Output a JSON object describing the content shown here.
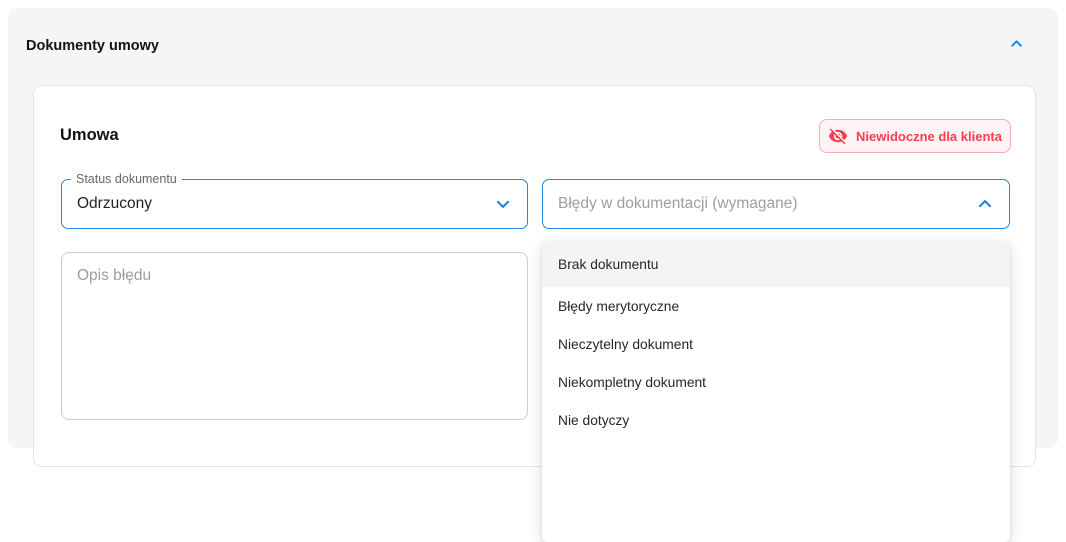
{
  "accordion": {
    "title": "Dokumenty umowy",
    "toggle_icon": "chevron-up-icon"
  },
  "card": {
    "title": "Umowa",
    "badge": {
      "label": "Niewidoczne dla klienta",
      "icon": "eye-slash-icon"
    },
    "status_select": {
      "label": "Status dokumentu",
      "value": "Odrzucony",
      "icon": "chevron-down-icon"
    },
    "errors_select": {
      "placeholder": "Błędy w dokumentacji (wymagane)",
      "icon": "chevron-up-icon"
    },
    "description_textarea": {
      "placeholder": "Opis błędu",
      "value": ""
    },
    "dropdown": {
      "items": [
        {
          "label": "Brak dokumentu",
          "highlighted": true
        },
        {
          "label": "Błędy merytoryczne",
          "highlighted": false
        },
        {
          "label": "Nieczytelny dokument",
          "highlighted": false
        },
        {
          "label": "Niekompletny dokument",
          "highlighted": false
        },
        {
          "label": "Nie dotyczy",
          "highlighted": false
        }
      ]
    }
  },
  "colors": {
    "accent_blue": "#1e88e5",
    "badge_red": "#f5414d",
    "panel_gray": "#f5f5f6",
    "highlight_gray": "#f4f4f5"
  }
}
